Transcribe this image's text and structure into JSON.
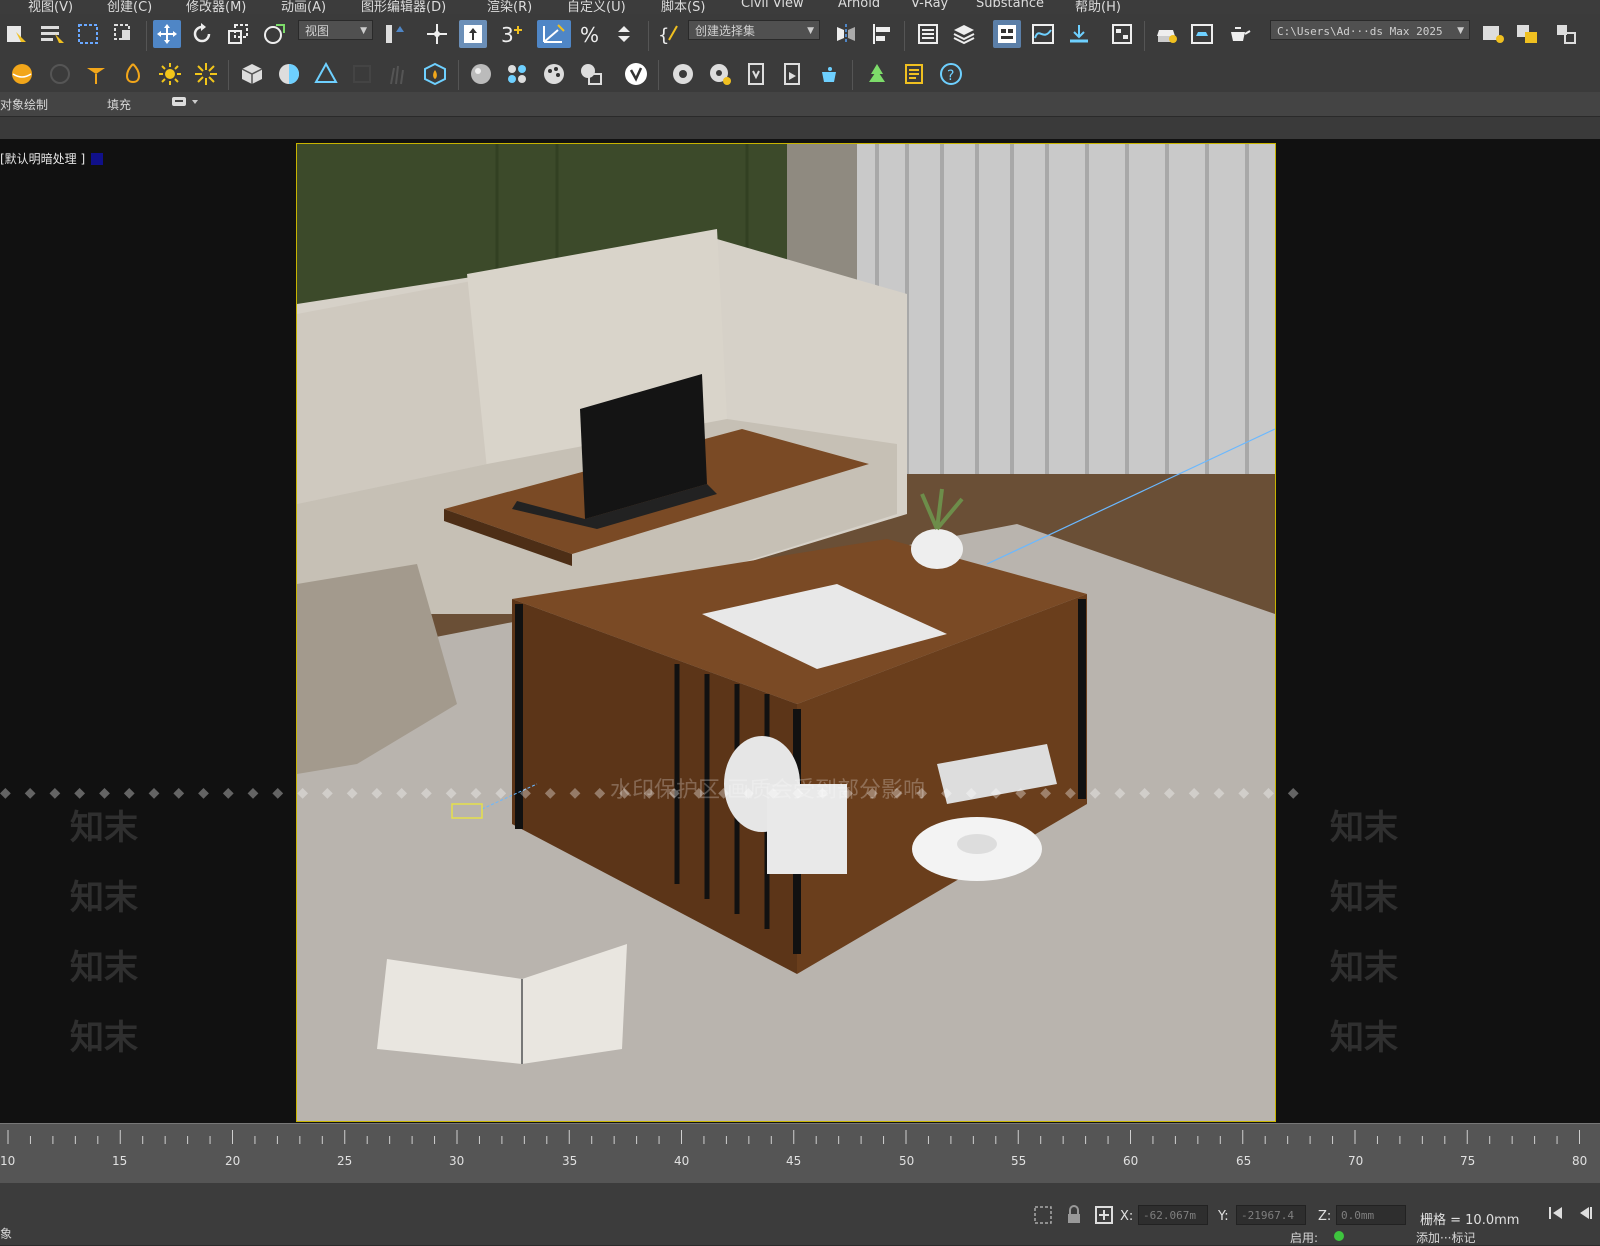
{
  "menu": {
    "items": [
      "视图(V)",
      "创建(C)",
      "修改器(M)",
      "动画(A)",
      "图形编辑器(D)",
      "渲染(R)",
      "自定义(U)",
      "脚本(S)",
      "Civil View",
      "Arnold",
      "V-Ray",
      "Substance",
      "帮助(H)"
    ]
  },
  "toolbar": {
    "view_dropdown": "视图",
    "selection_set_dropdown": "创建选择集",
    "project_path": "C:\\Users\\Ad···ds Max 2025"
  },
  "ribbon": {
    "tabs": [
      "对象绘制",
      "填充"
    ]
  },
  "viewport": {
    "label": "[默认明暗处理 ]",
    "watermark_center": "水印保护区 画质会受到部分影响",
    "watermark_brand": "知末"
  },
  "timeline": {
    "ticks": [
      "10",
      "15",
      "20",
      "25",
      "30",
      "35",
      "40",
      "45",
      "50",
      "55",
      "60",
      "65",
      "70",
      "75",
      "80"
    ]
  },
  "status": {
    "x_label": "X:",
    "x_value": "-62.067m",
    "y_label": "Y:",
    "y_value": "-21967.4",
    "z_label": "Z:",
    "z_value": "0.0mm",
    "grid": "栅格 = 10.0mm",
    "enable_label": "启用:",
    "add_tag": "添加···标记",
    "left_edge": "象"
  },
  "colors": {
    "accent": "#4f86c6",
    "viewport_border": "#c8b400",
    "label_swatch": "#10108a"
  }
}
